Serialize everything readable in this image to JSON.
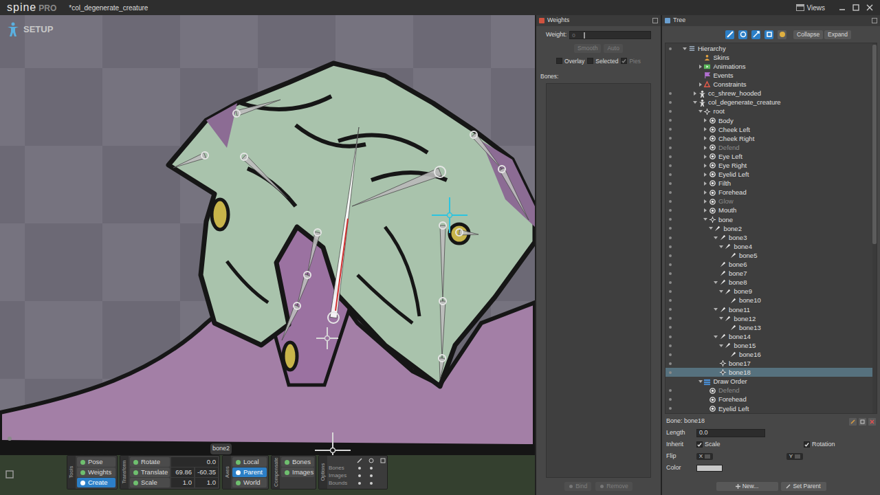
{
  "app": {
    "logo": "spine",
    "edition": "PRO",
    "title": "*col_degenerate_creature",
    "views": "Views"
  },
  "viewport": {
    "mode": "SETUP",
    "tooltip": "bone2"
  },
  "toolbar": {
    "tools": {
      "title": "Tools",
      "items": [
        {
          "label": "Pose",
          "selected": false
        },
        {
          "label": "Weights",
          "selected": false
        },
        {
          "label": "Create",
          "selected": true
        }
      ]
    },
    "transform": {
      "title": "Transform",
      "rows": [
        {
          "label": "Rotate",
          "selected": false,
          "values": [
            "0.0"
          ]
        },
        {
          "label": "Translate",
          "selected": false,
          "values": [
            "69.86",
            "-60.35"
          ]
        },
        {
          "label": "Scale",
          "selected": false,
          "values": [
            "1.0",
            "1.0"
          ]
        }
      ]
    },
    "axes": {
      "title": "Axes",
      "items": [
        {
          "label": "Local",
          "selected": false
        },
        {
          "label": "Parent",
          "selected": true
        },
        {
          "label": "World",
          "selected": false
        }
      ]
    },
    "compensate": {
      "title": "Compensate",
      "items": [
        {
          "label": "Bones",
          "selected": false
        },
        {
          "label": "Images",
          "selected": false
        }
      ]
    },
    "options": {
      "title": "Options",
      "rows": [
        {
          "label": "Bones",
          "flags": [
            true,
            true,
            false
          ]
        },
        {
          "label": "Images",
          "flags": [
            true,
            true,
            false
          ]
        },
        {
          "label": "Bounds",
          "flags": [
            true,
            true,
            false
          ]
        }
      ]
    }
  },
  "weights": {
    "title": "Weights",
    "weight_label": "Weight:",
    "weight_value": "0",
    "weight_level": 0,
    "buttons": [
      {
        "label": "Smooth",
        "disabled": true
      },
      {
        "label": "Auto",
        "disabled": true
      }
    ],
    "checks": [
      {
        "label": "Overlay",
        "checked": false,
        "disabled": false
      },
      {
        "label": "Selected",
        "checked": false,
        "disabled": false
      },
      {
        "label": "Pies",
        "checked": true,
        "disabled": true
      }
    ],
    "bones_label": "Bones:",
    "bones": [],
    "footer": [
      {
        "label": "Bind",
        "disabled": true
      },
      {
        "label": "Remove",
        "disabled": true
      }
    ]
  },
  "tree": {
    "title": "Tree",
    "filters": [
      {
        "selected": true
      },
      {
        "selected": true
      },
      {
        "selected": true
      },
      {
        "selected": true
      },
      {
        "selected": false
      }
    ],
    "buttons": [
      "Collapse",
      "Expand"
    ],
    "items": [
      {
        "label": "Hierarchy",
        "depth": 0,
        "kind": "hierarchy",
        "leaf": false,
        "expanded": true,
        "selected": false,
        "dimmed": false,
        "visible": true
      },
      {
        "label": "Skins",
        "depth": 3,
        "kind": "skins",
        "leaf": true,
        "expanded": false,
        "selected": false,
        "dimmed": false,
        "visible": false
      },
      {
        "label": "Animations",
        "depth": 3,
        "kind": "animations",
        "leaf": false,
        "expanded": false,
        "selected": false,
        "dimmed": false,
        "visible": false
      },
      {
        "label": "Events",
        "depth": 3,
        "kind": "events",
        "leaf": true,
        "expanded": false,
        "selected": false,
        "dimmed": false,
        "visible": false
      },
      {
        "label": "Constraints",
        "depth": 3,
        "kind": "constraints",
        "leaf": false,
        "expanded": false,
        "selected": false,
        "dimmed": false,
        "visible": false
      },
      {
        "label": "cc_shrew_hooded",
        "depth": 2,
        "kind": "skeleton",
        "leaf": false,
        "expanded": false,
        "selected": false,
        "dimmed": false,
        "visible": true
      },
      {
        "label": "col_degenerate_creature",
        "depth": 2,
        "kind": "skeleton",
        "leaf": false,
        "expanded": true,
        "selected": false,
        "dimmed": false,
        "visible": true
      },
      {
        "label": "root",
        "depth": 3,
        "kind": "root",
        "leaf": false,
        "expanded": true,
        "selected": false,
        "dimmed": false,
        "visible": true
      },
      {
        "label": "Body",
        "depth": 4,
        "kind": "slot",
        "leaf": false,
        "expanded": false,
        "selected": false,
        "dimmed": false,
        "visible": true
      },
      {
        "label": "Cheek Left",
        "depth": 4,
        "kind": "slot",
        "leaf": false,
        "expanded": false,
        "selected": false,
        "dimmed": false,
        "visible": true
      },
      {
        "label": "Cheek Right",
        "depth": 4,
        "kind": "slot",
        "leaf": false,
        "expanded": false,
        "selected": false,
        "dimmed": false,
        "visible": true
      },
      {
        "label": "Defend",
        "depth": 4,
        "kind": "slot",
        "leaf": false,
        "expanded": false,
        "selected": false,
        "dimmed": true,
        "visible": true
      },
      {
        "label": "Eye Left",
        "depth": 4,
        "kind": "slot",
        "leaf": false,
        "expanded": false,
        "selected": false,
        "dimmed": false,
        "visible": true
      },
      {
        "label": "Eye Right",
        "depth": 4,
        "kind": "slot",
        "leaf": false,
        "expanded": false,
        "selected": false,
        "dimmed": false,
        "visible": true
      },
      {
        "label": "Eyelid Left",
        "depth": 4,
        "kind": "slot",
        "leaf": false,
        "expanded": false,
        "selected": false,
        "dimmed": false,
        "visible": true
      },
      {
        "label": "Filth",
        "depth": 4,
        "kind": "slot",
        "leaf": false,
        "expanded": false,
        "selected": false,
        "dimmed": false,
        "visible": true
      },
      {
        "label": "Forehead",
        "depth": 4,
        "kind": "slot",
        "leaf": false,
        "expanded": false,
        "selected": false,
        "dimmed": false,
        "visible": true
      },
      {
        "label": "Glow",
        "depth": 4,
        "kind": "slot",
        "leaf": false,
        "expanded": false,
        "selected": false,
        "dimmed": true,
        "visible": true
      },
      {
        "label": "Mouth",
        "depth": 4,
        "kind": "slot",
        "leaf": false,
        "expanded": false,
        "selected": false,
        "dimmed": false,
        "visible": true
      },
      {
        "label": "bone",
        "depth": 4,
        "kind": "root",
        "leaf": false,
        "expanded": true,
        "selected": false,
        "dimmed": false,
        "visible": true
      },
      {
        "label": "bone2",
        "depth": 5,
        "kind": "bone",
        "leaf": false,
        "expanded": true,
        "selected": false,
        "dimmed": false,
        "visible": true
      },
      {
        "label": "bone3",
        "depth": 6,
        "kind": "bone",
        "leaf": false,
        "expanded": true,
        "selected": false,
        "dimmed": false,
        "visible": true
      },
      {
        "label": "bone4",
        "depth": 7,
        "kind": "bone",
        "leaf": false,
        "expanded": true,
        "selected": false,
        "dimmed": false,
        "visible": true
      },
      {
        "label": "bone5",
        "depth": 8,
        "kind": "bone",
        "leaf": true,
        "expanded": false,
        "selected": false,
        "dimmed": false,
        "visible": true
      },
      {
        "label": "bone6",
        "depth": 6,
        "kind": "bone",
        "leaf": true,
        "expanded": false,
        "selected": false,
        "dimmed": false,
        "visible": true
      },
      {
        "label": "bone7",
        "depth": 6,
        "kind": "bone",
        "leaf": true,
        "expanded": false,
        "selected": false,
        "dimmed": false,
        "visible": true
      },
      {
        "label": "bone8",
        "depth": 6,
        "kind": "bone",
        "leaf": false,
        "expanded": true,
        "selected": false,
        "dimmed": false,
        "visible": true
      },
      {
        "label": "bone9",
        "depth": 7,
        "kind": "bone",
        "leaf": false,
        "expanded": true,
        "selected": false,
        "dimmed": false,
        "visible": true
      },
      {
        "label": "bone10",
        "depth": 8,
        "kind": "bone",
        "leaf": true,
        "expanded": false,
        "selected": false,
        "dimmed": false,
        "visible": true
      },
      {
        "label": "bone11",
        "depth": 6,
        "kind": "bone",
        "leaf": false,
        "expanded": true,
        "selected": false,
        "dimmed": false,
        "visible": true
      },
      {
        "label": "bone12",
        "depth": 7,
        "kind": "bone",
        "leaf": false,
        "expanded": true,
        "selected": false,
        "dimmed": false,
        "visible": true
      },
      {
        "label": "bone13",
        "depth": 8,
        "kind": "bone",
        "leaf": true,
        "expanded": false,
        "selected": false,
        "dimmed": false,
        "visible": true
      },
      {
        "label": "bone14",
        "depth": 6,
        "kind": "bone",
        "leaf": false,
        "expanded": true,
        "selected": false,
        "dimmed": false,
        "visible": true
      },
      {
        "label": "bone15",
        "depth": 7,
        "kind": "bone",
        "leaf": false,
        "expanded": true,
        "selected": false,
        "dimmed": false,
        "visible": true
      },
      {
        "label": "bone16",
        "depth": 8,
        "kind": "bone",
        "leaf": true,
        "expanded": false,
        "selected": false,
        "dimmed": false,
        "visible": true
      },
      {
        "label": "bone17",
        "depth": 6,
        "kind": "point-bone",
        "leaf": true,
        "expanded": false,
        "selected": false,
        "dimmed": false,
        "visible": true
      },
      {
        "label": "bone18",
        "depth": 6,
        "kind": "point-bone",
        "leaf": true,
        "expanded": false,
        "selected": true,
        "dimmed": false,
        "visible": true
      },
      {
        "label": "Draw Order",
        "depth": 3,
        "kind": "draw-order",
        "leaf": false,
        "expanded": true,
        "selected": false,
        "dimmed": false,
        "visible": false
      },
      {
        "label": "Defend",
        "depth": 4,
        "kind": "slot",
        "leaf": true,
        "expanded": false,
        "selected": false,
        "dimmed": true,
        "visible": true
      },
      {
        "label": "Forehead",
        "depth": 4,
        "kind": "slot",
        "leaf": true,
        "expanded": false,
        "selected": false,
        "dimmed": false,
        "visible": true
      },
      {
        "label": "Eyelid Left",
        "depth": 4,
        "kind": "slot",
        "leaf": true,
        "expanded": false,
        "selected": false,
        "dimmed": false,
        "visible": true
      }
    ],
    "properties": {
      "heading": "Bone: bone18",
      "length": {
        "label": "Length",
        "value": "0.0"
      },
      "inherit": {
        "label": "Inherit",
        "options": [
          {
            "label": "Scale",
            "checked": true
          },
          {
            "label": "Rotation",
            "checked": true
          }
        ]
      },
      "flip": {
        "label": "Flip",
        "options": [
          {
            "label": "X",
            "checked": false
          },
          {
            "label": "Y",
            "checked": false
          }
        ]
      },
      "color": {
        "label": "Color",
        "value": "#c9c9c9"
      }
    },
    "footer": [
      "New...",
      "Set Parent"
    ]
  }
}
